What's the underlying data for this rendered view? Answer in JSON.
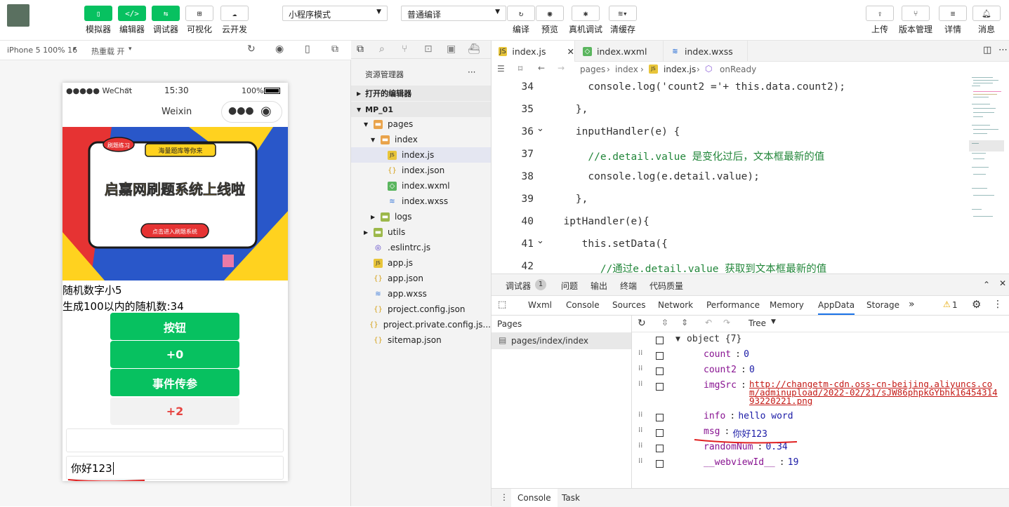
{
  "toolbar": {
    "simulator": "模拟器",
    "editor": "编辑器",
    "debugger": "调试器",
    "visual": "可视化",
    "cloud": "云开发",
    "mode_select": "小程序模式",
    "compile_select": "普通编译",
    "compile": "编译",
    "preview": "预览",
    "real_debug": "真机调试",
    "clear_cache": "清缓存",
    "upload": "上传",
    "version": "版本管理",
    "details": "详情",
    "messages": "消息"
  },
  "simbar": {
    "device": "iPhone 5 100% 16",
    "hot_reload": "热重载 开"
  },
  "phone": {
    "carrier": "●●●●● WeChat",
    "time": "15:30",
    "battery": "100%",
    "nav_title": "Weixin",
    "banner": {
      "tag1": "刷题练习",
      "tag2": "海量题库等你来",
      "headline": "启嘉网刷题系统上线啦",
      "bottom": "点击进入刷题系统"
    },
    "text1": "随机数字小5",
    "text2": "生成100以内的随机数:34",
    "btn1": "按钮",
    "btn2": "+0",
    "btn3": "事件传参",
    "btn4": "+2",
    "input2_value": "你好123"
  },
  "explorer": {
    "title": "资源管理器",
    "more": "···",
    "open_editors": "打开的编辑器",
    "project": "MP_01",
    "items": [
      {
        "label": "pages",
        "depth": 1,
        "type": "folder-open"
      },
      {
        "label": "index",
        "depth": 2,
        "type": "folder-open"
      },
      {
        "label": "index.js",
        "depth": 3,
        "type": "js"
      },
      {
        "label": "index.json",
        "depth": 3,
        "type": "json"
      },
      {
        "label": "index.wxml",
        "depth": 3,
        "type": "wxml"
      },
      {
        "label": "index.wxss",
        "depth": 3,
        "type": "wxss"
      },
      {
        "label": "logs",
        "depth": 2,
        "type": "folder"
      },
      {
        "label": "utils",
        "depth": 1,
        "type": "folder"
      },
      {
        "label": ".eslintrc.js",
        "depth": 1,
        "type": "eslint"
      },
      {
        "label": "app.js",
        "depth": 1,
        "type": "js"
      },
      {
        "label": "app.json",
        "depth": 1,
        "type": "json"
      },
      {
        "label": "app.wxss",
        "depth": 1,
        "type": "wxss"
      },
      {
        "label": "project.config.json",
        "depth": 1,
        "type": "json"
      },
      {
        "label": "project.private.config.js...",
        "depth": 1,
        "type": "json"
      },
      {
        "label": "sitemap.json",
        "depth": 1,
        "type": "json"
      }
    ]
  },
  "editor": {
    "tabs": [
      "index.js",
      "index.wxml",
      "index.wxss"
    ],
    "breadcrumb": [
      "pages",
      "index",
      "index.js",
      "onReady"
    ],
    "lines": [
      {
        "n": "34",
        "t": "      console.log('count2 ='+ this.data.count2);"
      },
      {
        "n": "35",
        "t": "    },"
      },
      {
        "n": "36",
        "t": "    inputHandler(e) {"
      },
      {
        "n": "37",
        "t": "      //e.detail.value 是变化过后，文本框最新的值"
      },
      {
        "n": "38",
        "t": "      console.log(e.detail.value);"
      },
      {
        "n": "39",
        "t": "    },"
      },
      {
        "n": "40",
        "t": "  iptHandler(e){"
      },
      {
        "n": "41",
        "t": "     this.setData({"
      },
      {
        "n": "42",
        "t": "        //通过e.detail.value 获取到文本框最新的值"
      }
    ]
  },
  "devtools": {
    "top_tabs": [
      "调试器",
      "问题",
      "输出",
      "终端",
      "代码质量"
    ],
    "badge": "1",
    "panels": [
      "Wxml",
      "Console",
      "Sources",
      "Network",
      "Performance",
      "Memory",
      "AppData",
      "Storage"
    ],
    "warn_count": "1",
    "pages_header": "Pages",
    "page_item": "pages/index/index",
    "view_mode": "Tree",
    "root": "object {7}",
    "data": [
      {
        "key": "count",
        "value": "0",
        "kind": "num"
      },
      {
        "key": "count2",
        "value": "0",
        "kind": "num"
      },
      {
        "key": "imgSrc",
        "value": "http://changetm-cdn.oss-cn-beijing.aliyuncs.com/adminupload/2022-02/21/sJW86phpkGYbhk1645431493220221.png",
        "kind": "str"
      },
      {
        "key": "info",
        "value": "hello word",
        "kind": "text"
      },
      {
        "key": "msg",
        "value": "你好123",
        "kind": "text"
      },
      {
        "key": "randomNum",
        "value": "0.34",
        "kind": "num"
      },
      {
        "key": "__webviewId__",
        "value": "19",
        "kind": "num"
      }
    ],
    "bottom_tabs": [
      "Console",
      "Task"
    ]
  },
  "colors": {
    "accent": "#07c160",
    "selection": "#e4e6f1"
  }
}
